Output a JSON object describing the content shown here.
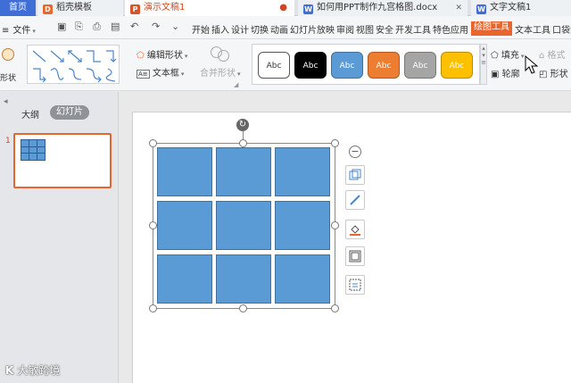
{
  "tabs": {
    "home": "首页",
    "template": "稻壳模板",
    "active": "演示文稿1",
    "doc1": "如何用PPT制作九宫格图.docx",
    "doc2": "文字文稿1"
  },
  "menubar": {
    "file_label": "文件",
    "items": [
      "开始",
      "插入",
      "设计",
      "切换",
      "动画",
      "幻灯片放映",
      "审阅",
      "视图",
      "安全",
      "开发工具",
      "特色应用"
    ],
    "active_item": "绘图工具",
    "trailing": [
      "文本工具",
      "口袋动画"
    ]
  },
  "ribbon": {
    "shape_label": "形状",
    "edit_shape": "编辑形状",
    "textbox": "文本框",
    "merge_shape": "合并形状",
    "styles": [
      {
        "label": "Abc",
        "bg": "#ffffff",
        "fg": "#333333",
        "border": "#555555"
      },
      {
        "label": "Abc",
        "bg": "#000000",
        "fg": "#ffffff",
        "border": "#000000"
      },
      {
        "label": "Abc",
        "bg": "#5b9bd5",
        "fg": "#ffffff",
        "border": "#41719c"
      },
      {
        "label": "Abc",
        "bg": "#ed7d31",
        "fg": "#ffffff",
        "border": "#ae5a21"
      },
      {
        "label": "Abc",
        "bg": "#a5a5a5",
        "fg": "#ffffff",
        "border": "#787878"
      },
      {
        "label": "Abc",
        "bg": "#ffc000",
        "fg": "#ffffff",
        "border": "#bc8c00"
      }
    ],
    "fill": "填充",
    "outline": "轮廓",
    "format": "格式",
    "shape_effect": "形状"
  },
  "left_panel": {
    "outline_tab": "大纲",
    "slides_tab": "幻灯片",
    "slide_number": "1"
  },
  "table": {
    "rows": 3,
    "cols": 3,
    "cell_color": "#5b9bd5",
    "border_color": "#41719c"
  },
  "colors": {
    "accent_orange": "#e8662d",
    "home_tab_blue": "#3f6fd6"
  },
  "watermark": {
    "logo": "K",
    "text": "大敏跨境"
  }
}
